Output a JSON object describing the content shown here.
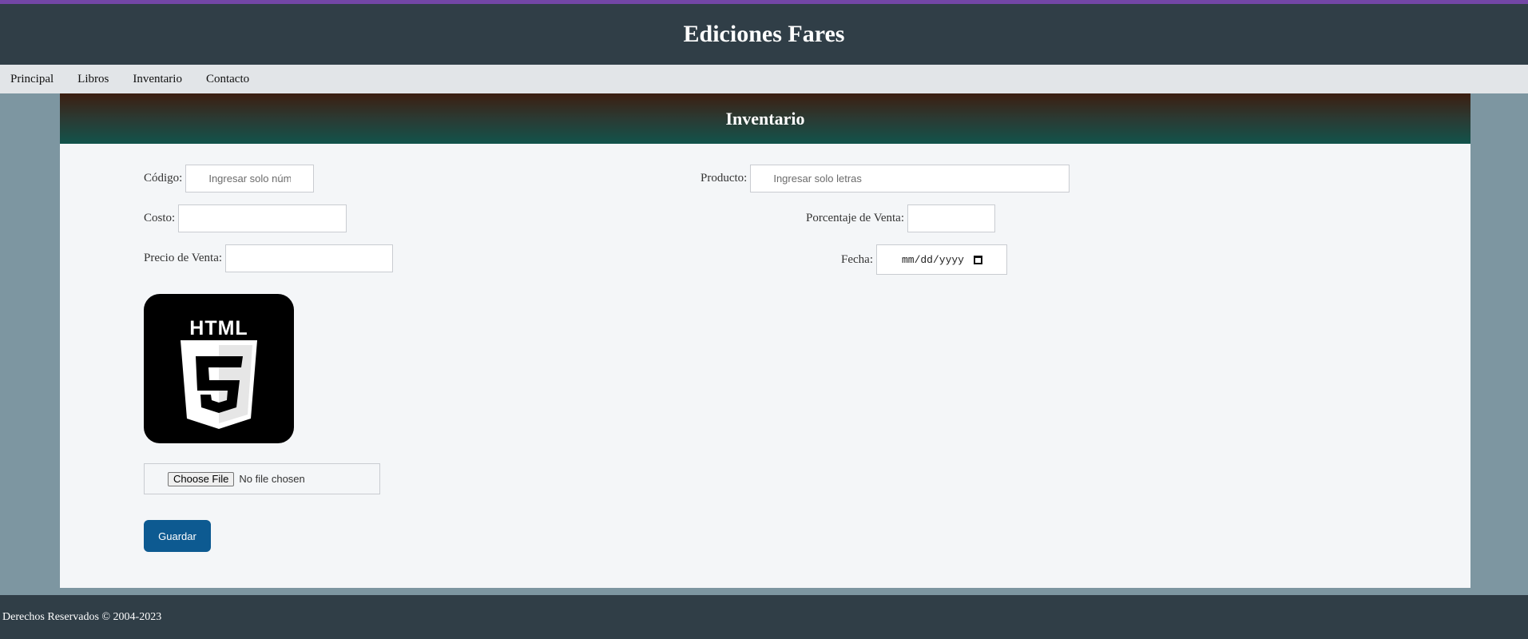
{
  "header": {
    "title": "Ediciones Fares"
  },
  "nav": {
    "items": [
      {
        "label": "Principal"
      },
      {
        "label": "Libros"
      },
      {
        "label": "Inventario"
      },
      {
        "label": "Contacto"
      }
    ]
  },
  "panel": {
    "title": "Inventario"
  },
  "form": {
    "codigo": {
      "label": "Código:",
      "placeholder": "Ingresar solo núme"
    },
    "producto": {
      "label": "Producto:",
      "placeholder": "Ingresar solo letras"
    },
    "costo": {
      "label": "Costo:",
      "value": ""
    },
    "porcentaje": {
      "label": "Porcentaje de Venta:",
      "value": ""
    },
    "precio": {
      "label": "Precio de Venta:",
      "value": ""
    },
    "fecha": {
      "label": "Fecha:",
      "value": "mm/dd/yyyy"
    },
    "logo": {
      "text": "HTML",
      "icon": "html5-logo-icon"
    },
    "file": {
      "button_label": "Choose File",
      "status": "No file chosen"
    },
    "save_label": "Guardar"
  },
  "footer": {
    "text": "Derechos Reservados © 2004-2023"
  },
  "colors": {
    "header_bg": "#303e47",
    "nav_bg": "#e2e5e8",
    "accent_button": "#0d5a91",
    "top_line": "#7346a6"
  }
}
